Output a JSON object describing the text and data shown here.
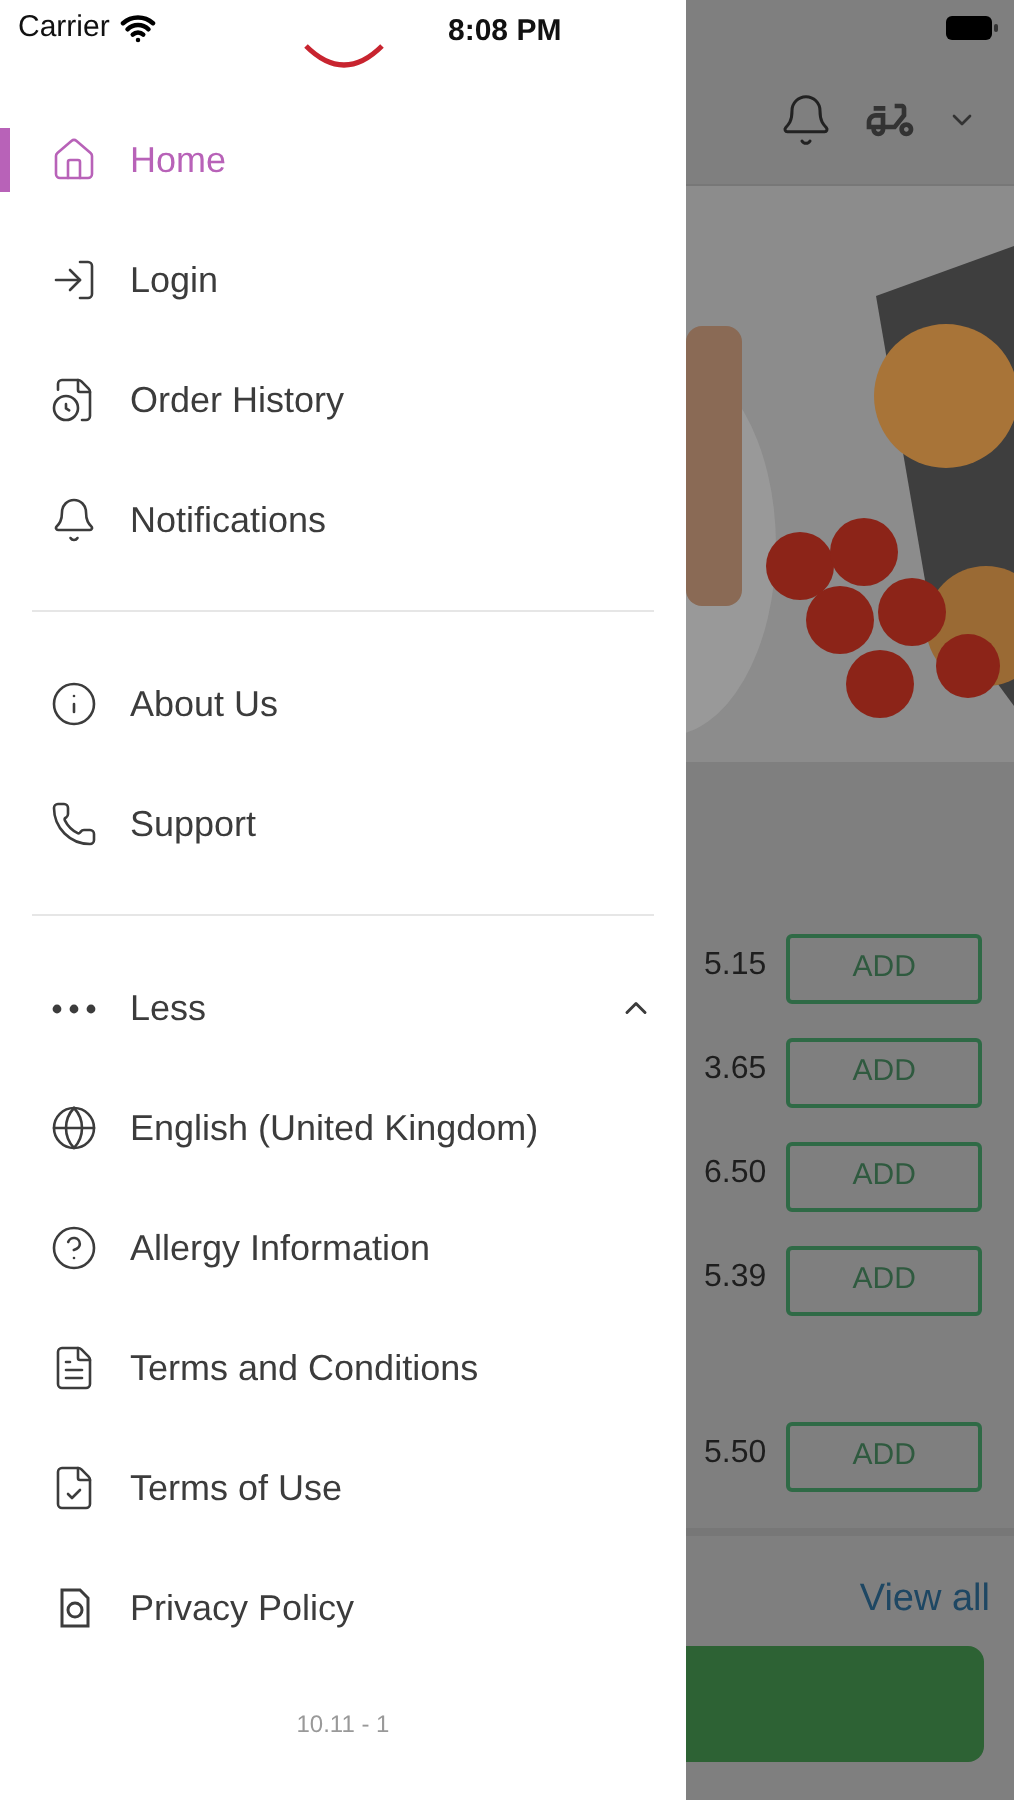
{
  "status_bar": {
    "carrier": "Carrier",
    "time": "8:08 PM"
  },
  "menu": {
    "sections": [
      {
        "items": [
          {
            "label": "Home",
            "selected": true
          },
          {
            "label": "Login",
            "selected": false
          },
          {
            "label": "Order History",
            "selected": false
          },
          {
            "label": "Notifications",
            "selected": false
          }
        ]
      },
      {
        "items": [
          {
            "label": "About Us",
            "selected": false
          },
          {
            "label": "Support",
            "selected": false
          }
        ]
      }
    ],
    "more": {
      "label": "Less",
      "expanded": true,
      "items": [
        {
          "label": "English (United Kingdom)",
          "selected": false
        },
        {
          "label": "Allergy Information",
          "selected": false
        },
        {
          "label": "Terms and Conditions",
          "selected": false
        },
        {
          "label": "Terms of Use",
          "selected": false
        },
        {
          "label": "Privacy Policy",
          "selected": false
        }
      ]
    },
    "version": "10.11 - 1"
  },
  "background": {
    "product_groups": [
      [
        {
          "price": "5.15",
          "button": "ADD"
        },
        {
          "price": "3.65",
          "button": "ADD"
        },
        {
          "price": "6.50",
          "button": "ADD"
        },
        {
          "price": "5.39",
          "button": "ADD"
        }
      ],
      [
        {
          "price": "5.50",
          "button": "ADD"
        }
      ]
    ],
    "link": "View all"
  }
}
